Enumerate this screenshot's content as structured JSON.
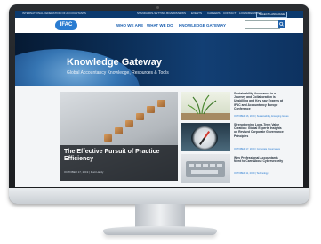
{
  "topbar": {
    "org_name": "INTERNATIONAL FEDERATION OF ACCOUNTANTS",
    "links": [
      "STANDARDS-SETTING BOARDS",
      "NEWS",
      "EVENTS",
      "CAREERS",
      "CONTACT",
      "LOGIN/REGISTER"
    ],
    "language": "SELECT LANGUAGE"
  },
  "nav": {
    "logo": "IFAC",
    "items": [
      "WHO WE ARE",
      "WHAT WE DO",
      "KNOWLEDGE GATEWAY"
    ]
  },
  "hero": {
    "title": "Knowledge Gateway",
    "subtitle": "Global Accountancy Knowledge, Resources & Tools"
  },
  "feature": {
    "title": "The Effective Pursuit of Practice Efficiency",
    "date": "OCTOBER 17, 2019 | Matt Hardy"
  },
  "articles": [
    {
      "title": "Sustainability Assurance in a Journey and Collaboration is Upskilling and Key, say Experts at IFAC and Accountancy Europe Conference",
      "date": "OCTOBER 16, 2019 | Sustainability, Emerging Issues"
    },
    {
      "title": "Strengthening Long-Term Value Creation: Global Experts Insights on Revised Corporate Governance Principles",
      "date": "OCTOBER 17, 2019 | Corporate Governance"
    },
    {
      "title": "Why Professional Accountants Need to Care About Cybersecurity",
      "date": "OCTOBER 11, 2019 | Technology"
    }
  ],
  "colors": {
    "brand_blue": "#1a5fb0",
    "topbar_blue": "#0c3a6e",
    "bezel": "#1f2226",
    "accent_date": "#2a7cd1"
  }
}
